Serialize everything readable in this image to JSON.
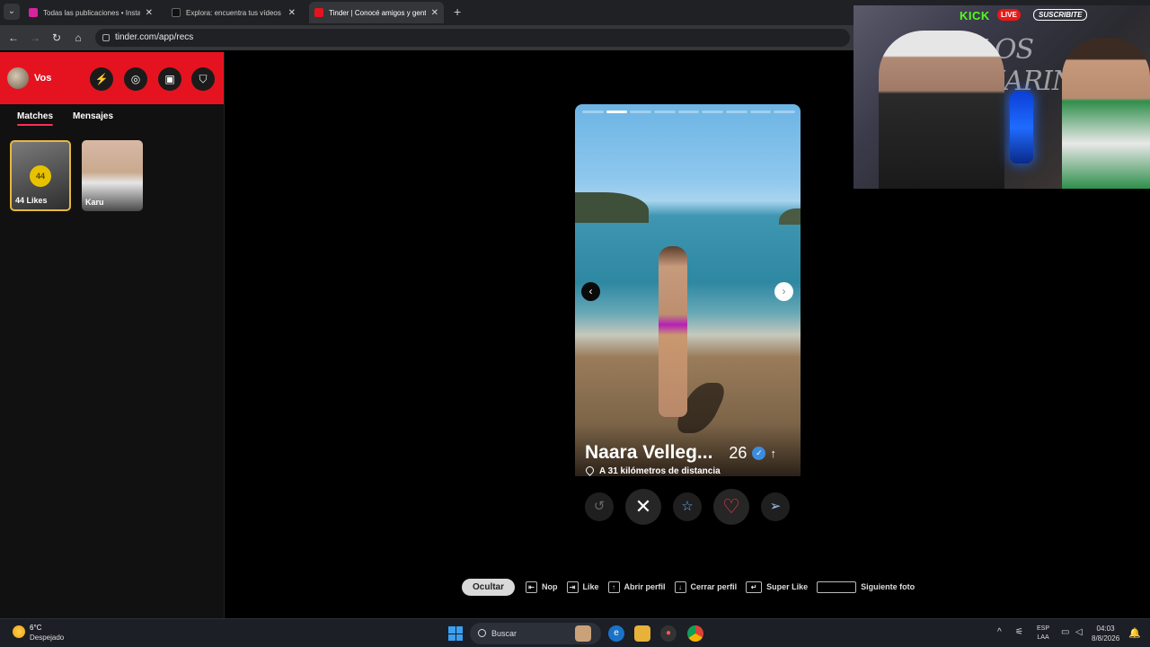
{
  "browser": {
    "tabs": [
      {
        "label": "Todas las publicaciones • Instag",
        "active": false,
        "color": "#d6249f"
      },
      {
        "label": "Explora: encuentra tus vídeos fa",
        "active": false,
        "color": "#111111"
      },
      {
        "label": "Tinder | Conocé amigos y gente",
        "active": true,
        "color": "#e5131f"
      }
    ],
    "new_tab": "+",
    "url": "tinder.com/app/recs"
  },
  "sidebar": {
    "user_name": "Vos",
    "tabs": [
      "Matches",
      "Mensajes"
    ],
    "likes_count": "44",
    "likes_label": "44 Likes",
    "match_name": "Karu"
  },
  "profile": {
    "name": "Naara Velleg...",
    "age": "26",
    "distance": "A 31 kilómetros de distancia",
    "photo_count": 9,
    "current_photo": 2
  },
  "hints": {
    "hide": "Ocultar",
    "nope": "Nop",
    "like": "Like",
    "open_profile": "Abrir perfil",
    "close_profile": "Cerrar perfil",
    "super_like": "Super Like",
    "next_photo": "Siguiente foto"
  },
  "stream": {
    "platform": "KICK",
    "live": "LIVE",
    "subscribe": "SUSCRIBITE",
    "logo": "LOS MARINOS"
  },
  "taskbar": {
    "temp": "6°C",
    "weather": "Despejado",
    "search": "Buscar",
    "lang1": "ESP",
    "lang2": "LAA",
    "time": "04:03",
    "date": "8/8/2026"
  },
  "colors": {
    "tinder_red": "#e5131f",
    "likes_gold": "#e7b93a",
    "kick_green": "#53fc18"
  }
}
